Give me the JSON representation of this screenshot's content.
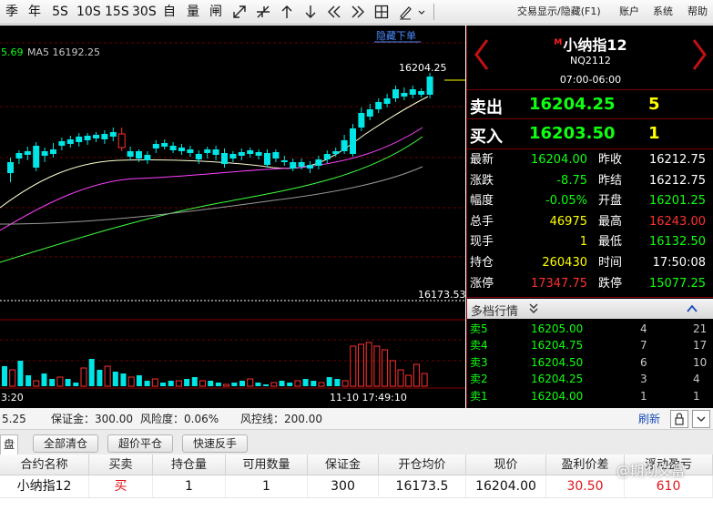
{
  "toolbar": {
    "periods": [
      "季",
      "年",
      "5S",
      "10S",
      "15S",
      "30S",
      "自",
      "量",
      "闸"
    ],
    "right_menu": [
      "交易显示/隐藏(F1)",
      "账户",
      "系统",
      "帮助"
    ]
  },
  "chart": {
    "ma_value_left": "5.69",
    "ma_label": "MA5 16192.25",
    "hide_order_link": "隐藏下单",
    "last_price_label": "16204.25",
    "avg_price_label": "16173.53",
    "time_left": "3:20",
    "time_right": "11-10 17:49:10"
  },
  "chart_data": {
    "type": "candlestick",
    "last_price": 16204.25,
    "reference_price": 16173.53,
    "ma5": 16192.25
  },
  "quote": {
    "marker": "M",
    "name": "小纳指12",
    "code": "NQ2112",
    "session": "07:00-06:00",
    "sell_label": "卖出",
    "sell_price": "16204.25",
    "sell_qty": "5",
    "buy_label": "买入",
    "buy_price": "16203.50",
    "buy_qty": "1",
    "stats": [
      {
        "l1": "最新",
        "v1": "16204.00",
        "c1": "green",
        "l2": "昨收",
        "v2": "16212.75",
        "c2": "white"
      },
      {
        "l1": "涨跌",
        "v1": "-8.75",
        "c1": "green",
        "l2": "昨结",
        "v2": "16212.75",
        "c2": "white"
      },
      {
        "l1": "幅度",
        "v1": "-0.05%",
        "c1": "green",
        "l2": "开盘",
        "v2": "16201.25",
        "c2": "green"
      },
      {
        "l1": "总手",
        "v1": "46975",
        "c1": "yellow",
        "l2": "最高",
        "v2": "16243.00",
        "c2": "red"
      },
      {
        "l1": "现手",
        "v1": "1",
        "c1": "yellow",
        "l2": "最低",
        "v2": "16132.50",
        "c2": "green"
      },
      {
        "l1": "持仓",
        "v1": "260430",
        "c1": "yellow",
        "l2": "时间",
        "v2": "17:50:08",
        "c2": "white"
      },
      {
        "l1": "涨停",
        "v1": "17347.75",
        "c1": "red",
        "l2": "跌停",
        "v2": "15077.25",
        "c2": "green"
      }
    ],
    "depth_title": "多档行情",
    "depth": [
      {
        "label": "卖5",
        "price": "16205.00",
        "qty": "4",
        "num": "21"
      },
      {
        "label": "卖4",
        "price": "16204.75",
        "qty": "7",
        "num": "17"
      },
      {
        "label": "卖3",
        "price": "16204.50",
        "qty": "6",
        "num": "10"
      },
      {
        "label": "卖2",
        "price": "16204.25",
        "qty": "3",
        "num": "4"
      },
      {
        "label": "卖1",
        "price": "16204.00",
        "qty": "1",
        "num": "1"
      }
    ]
  },
  "infobar": {
    "left_value": "5.25",
    "margin": "保证金：300.00",
    "risk": "风险度：0.06%",
    "risk_line": "风控线：200.00",
    "refresh": "刷新"
  },
  "actions": {
    "tab": "盘",
    "close_all": "全部清仓",
    "super_close": "超价平仓",
    "quick_reverse": "快速反手"
  },
  "table": {
    "headers": [
      "合约名称",
      "买卖",
      "持仓量",
      "可用数量",
      "保证金",
      "开仓均价",
      "现价",
      "盈利价差",
      "浮动盈亏"
    ],
    "row": [
      "小纳指12",
      "买",
      "1",
      "1",
      "300",
      "16173.5",
      "16204.00",
      "30.50",
      "610"
    ]
  },
  "watermark": "@期沏文富"
}
